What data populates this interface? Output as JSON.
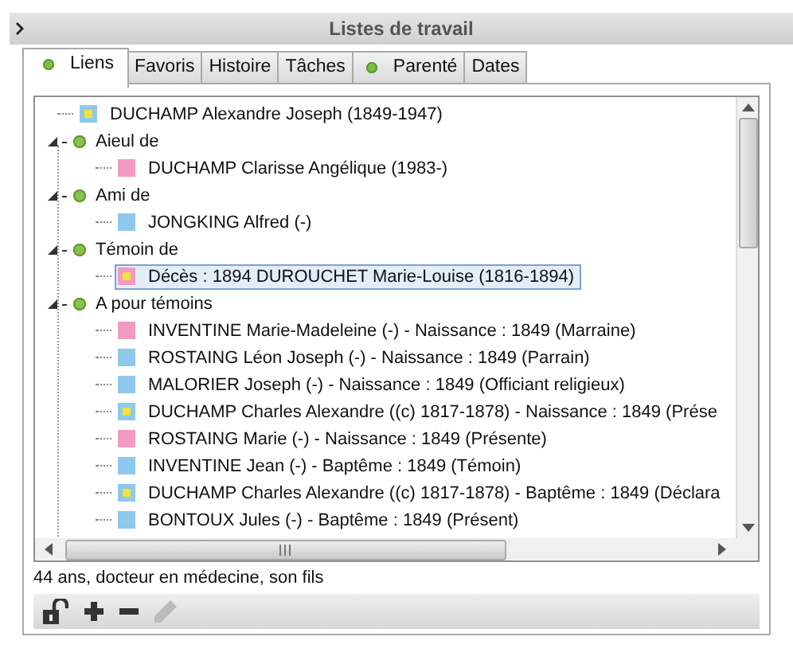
{
  "panel": {
    "title": "Listes de travail"
  },
  "tabs": [
    {
      "label": "Liens",
      "selected": true,
      "indicator": true
    },
    {
      "label": "Favoris",
      "selected": false,
      "indicator": false
    },
    {
      "label": "Histoire",
      "selected": false,
      "indicator": false
    },
    {
      "label": "Tâches",
      "selected": false,
      "indicator": false
    },
    {
      "label": "Parenté",
      "selected": false,
      "indicator": true
    },
    {
      "label": "Dates",
      "selected": false,
      "indicator": false
    }
  ],
  "tree": {
    "items": [
      {
        "kind": "person",
        "label": "DUCHAMP Alexandre Joseph (1849-1947)",
        "color": "#8ec8ec",
        "marked": true,
        "selected": false
      },
      {
        "kind": "group",
        "label": "Aieul de",
        "expanded": true,
        "children": [
          {
            "kind": "person",
            "label": "DUCHAMP Clarisse Angélique (1983-)",
            "color": "#f29ac0",
            "marked": false,
            "selected": false
          }
        ]
      },
      {
        "kind": "group",
        "label": "Ami de",
        "expanded": true,
        "children": [
          {
            "kind": "person",
            "label": "JONGKING Alfred (-)",
            "color": "#8ec8ec",
            "marked": false,
            "selected": false
          }
        ]
      },
      {
        "kind": "group",
        "label": "Témoin de",
        "expanded": true,
        "children": [
          {
            "kind": "person",
            "label": "Décès : 1894 DUROUCHET Marie-Louise (1816-1894)",
            "color": "#f29ac0",
            "marked": true,
            "selected": true
          }
        ]
      },
      {
        "kind": "group",
        "label": "A pour témoins",
        "expanded": true,
        "children": [
          {
            "kind": "person",
            "label": "INVENTINE Marie-Madeleine (-) - Naissance : 1849 (Marraine)",
            "color": "#f29ac0",
            "marked": false,
            "selected": false
          },
          {
            "kind": "person",
            "label": "ROSTAING Léon Joseph (-) - Naissance : 1849 (Parrain)",
            "color": "#8ec8ec",
            "marked": false,
            "selected": false
          },
          {
            "kind": "person",
            "label": "MALORIER Joseph (-) - Naissance : 1849 (Officiant religieux)",
            "color": "#8ec8ec",
            "marked": false,
            "selected": false
          },
          {
            "kind": "person",
            "label": "DUCHAMP Charles Alexandre ((c) 1817-1878) - Naissance : 1849 (Prése",
            "color": "#8ec8ec",
            "marked": true,
            "selected": false
          },
          {
            "kind": "person",
            "label": "ROSTAING Marie (-) - Naissance : 1849 (Présente)",
            "color": "#f29ac0",
            "marked": false,
            "selected": false
          },
          {
            "kind": "person",
            "label": "INVENTINE Jean (-) - Baptême : 1849 (Témoin)",
            "color": "#8ec8ec",
            "marked": false,
            "selected": false
          },
          {
            "kind": "person",
            "label": "DUCHAMP Charles Alexandre ((c) 1817-1878) - Baptême : 1849 (Déclara",
            "color": "#8ec8ec",
            "marked": true,
            "selected": false
          },
          {
            "kind": "person",
            "label": "BONTOUX Jules (-) - Baptême : 1849 (Présent)",
            "color": "#8ec8ec",
            "marked": false,
            "selected": false
          }
        ]
      }
    ]
  },
  "status": "44 ans, docteur en médecine, son fils",
  "toolbar": [
    {
      "kind": "unlock",
      "disabled": false
    },
    {
      "kind": "add",
      "disabled": false
    },
    {
      "kind": "remove",
      "disabled": false
    },
    {
      "kind": "edit",
      "disabled": true
    }
  ]
}
